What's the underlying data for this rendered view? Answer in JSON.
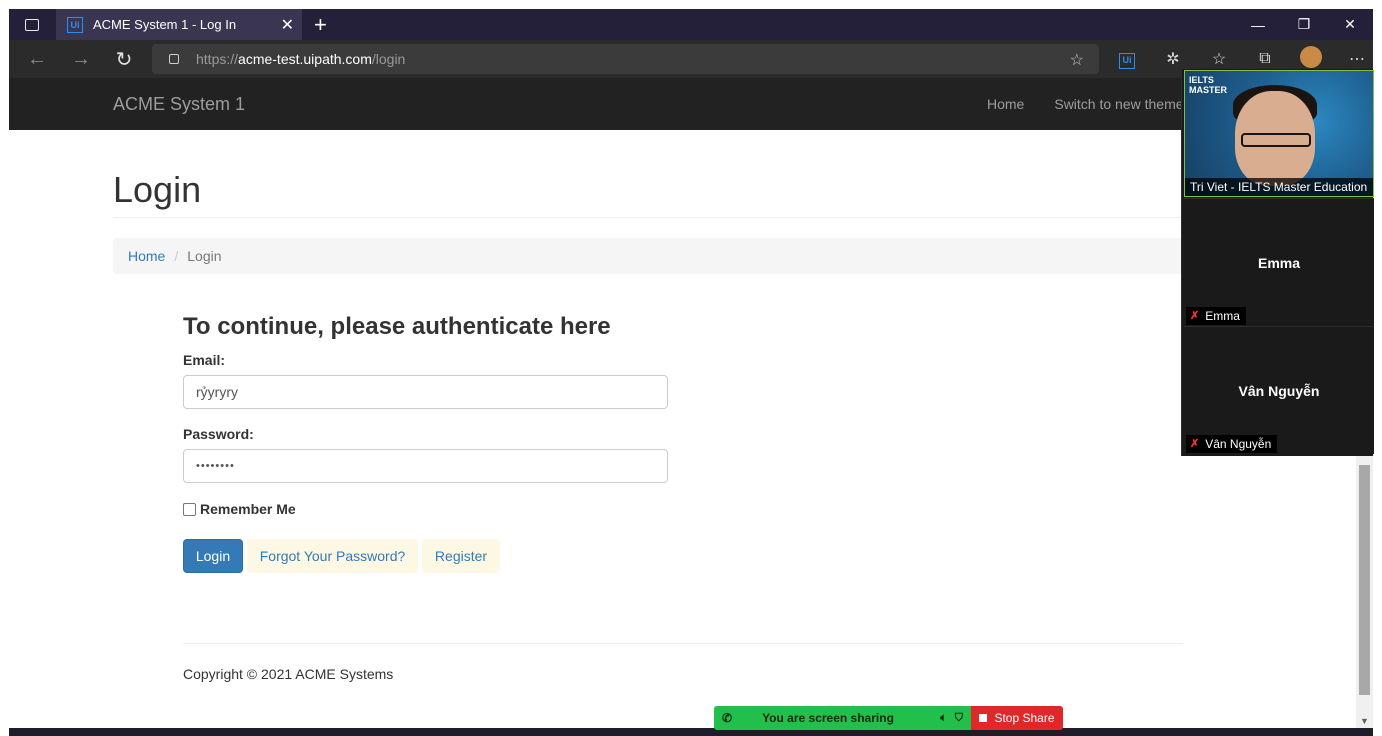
{
  "browser": {
    "tab_title": "ACME System 1 - Log In",
    "tab_favicon_text": "Ui",
    "new_tab_symbol": "+",
    "url_scheme": "https://",
    "url_host": "acme-test.uipath.com",
    "url_path": "/login",
    "extension_ui_text": "Ui",
    "window_controls": {
      "minimize": "—",
      "restore": "❐",
      "close": "✕"
    }
  },
  "navbar": {
    "brand": "ACME System 1",
    "links": [
      "Home",
      "Switch to new theme"
    ]
  },
  "page": {
    "title": "Login",
    "breadcrumb": {
      "home": "Home",
      "separator": "/",
      "current": "Login"
    }
  },
  "form": {
    "heading": "To continue, please authenticate here",
    "email_label": "Email:",
    "email_value": "rỷyryry",
    "password_label": "Password:",
    "password_value": "••••••••",
    "remember_label": "Remember Me",
    "login_button": "Login",
    "forgot_link": "Forgot Your Password?",
    "register_link": "Register"
  },
  "footer": {
    "copyright": "Copyright © 2021 ACME Systems"
  },
  "zoom": {
    "video_participant": "Tri Viet - IELTS Master Education",
    "logo_text": "IELTS MASTER",
    "participants": [
      {
        "center_name": "Emma",
        "label": "Emma"
      },
      {
        "center_name": "Vân Nguyễn",
        "label": "Vân Nguyễn"
      }
    ],
    "share_text": "You are screen sharing",
    "stop_share": "Stop Share"
  },
  "colors": {
    "navbar_bg": "#222222",
    "link": "#337ab7",
    "primary_button": "#337ab7",
    "link_button_bg": "#fcf8e3",
    "share_green": "#22c04b",
    "stop_red": "#e02828"
  }
}
